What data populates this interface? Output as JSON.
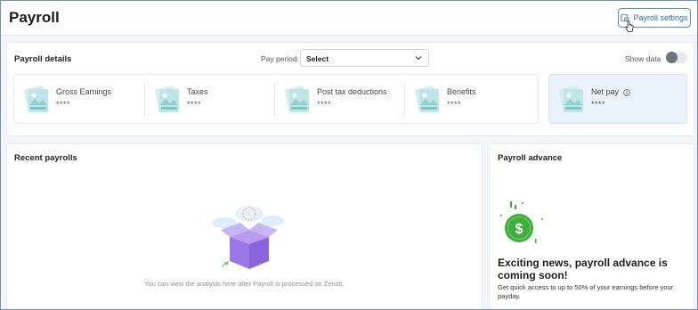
{
  "header": {
    "title": "Payroll",
    "settings_label": "Payroll settings",
    "settings_icon": "gear-settings-icon"
  },
  "payroll_details": {
    "title": "Payroll details",
    "pay_period_label": "Pay period:",
    "pay_period_value": "Select",
    "show_data_label": "Show data",
    "show_data_on": false,
    "cards": [
      {
        "label": "Gross Earnings",
        "value": "****"
      },
      {
        "label": "Taxes",
        "value": "****"
      },
      {
        "label": "Post tax deductions",
        "value": "****"
      },
      {
        "label": "Benefits",
        "value": "****"
      },
      {
        "label": "Net pay",
        "value": "****"
      }
    ]
  },
  "recent_payrolls": {
    "title": "Recent payrolls",
    "empty_text": "You can view the analysis here after Payroll is processed on Zenoti."
  },
  "payroll_advance": {
    "title": "Payroll advance",
    "headline": "Exciting news, payroll advance is coming soon!",
    "subtext": "Get quick access to up to 50% of your earnings before your payday."
  },
  "colors": {
    "accent": "#2b6cb0",
    "netpay_bg": "#eaf2fb",
    "coin_green": "#3fae3a"
  }
}
